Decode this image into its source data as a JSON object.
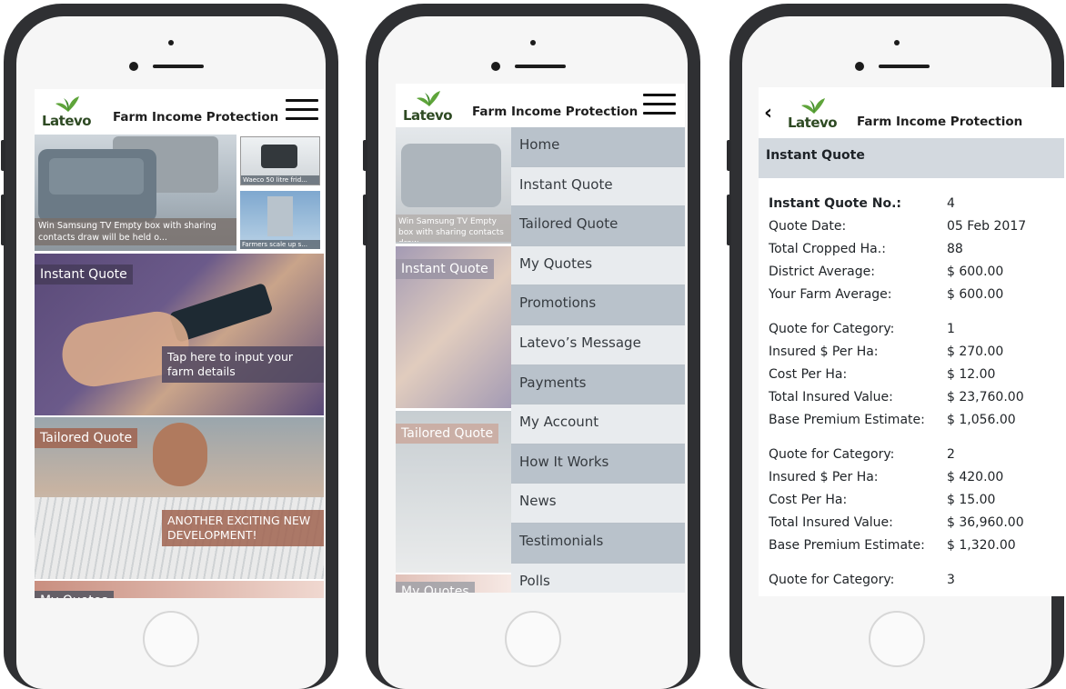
{
  "app": {
    "brand": "Latevo",
    "title": "Farm Income Protection",
    "colors": {
      "logo_green": "#5ea43a",
      "logo_text": "#2e4a23",
      "menu_bg": "#dfe3e7",
      "menu_alt": "#b9c2cb",
      "header_bar": "#d3d9df"
    }
  },
  "phone1": {
    "banner": {
      "main_caption": "Win Samsung TV Empty box with sharing contacts draw will be held o...",
      "side_top": "Waeco 50 litre frid...",
      "side_bottom": "Farmers scale up s..."
    },
    "tiles": [
      {
        "tag": "Instant Quote",
        "caption": "Tap here to input your farm details"
      },
      {
        "tag": "Tailored Quote",
        "caption": "ANOTHER EXCITING NEW DEVELOPMENT!"
      },
      {
        "tag": "My Quotes"
      }
    ]
  },
  "phone2": {
    "bg_texts": {
      "banner_caption": "Win Samsung TV Empty box with sharing contacts draw",
      "tile1": "Instant Quote",
      "tile2": "Tailored Quote",
      "tile3": "My Quotes"
    },
    "menu": [
      {
        "label": "Home"
      },
      {
        "label": "Instant Quote"
      },
      {
        "label": "Tailored Quote"
      },
      {
        "label": "My Quotes"
      },
      {
        "label": "Promotions"
      },
      {
        "label": "Latevo’s Message"
      },
      {
        "label": "Payments"
      },
      {
        "label": "My Account"
      },
      {
        "label": "How It Works"
      },
      {
        "label": "News"
      },
      {
        "label": "Testimonials"
      },
      {
        "label": "Polls"
      }
    ]
  },
  "phone3": {
    "section_title": "Instant Quote",
    "rows": [
      {
        "k": "Instant Quote No.:",
        "v": "4"
      },
      {
        "k": "Quote Date:",
        "v": "05 Feb 2017"
      },
      {
        "k": "Total Cropped Ha.:",
        "v": "88"
      },
      {
        "k": "District Average:",
        "v": "$ 600.00"
      },
      {
        "k": "Your Farm Average:",
        "v": "$ 600.00"
      },
      {
        "k": "Quote for Category:",
        "v": "1"
      },
      {
        "k": "Insured $ Per Ha:",
        "v": "$ 270.00"
      },
      {
        "k": "Cost Per Ha:",
        "v": "$ 12.00"
      },
      {
        "k": "Total Insured Value:",
        "v": "$ 23,760.00"
      },
      {
        "k": "Base Premium Estimate:",
        "v": "$ 1,056.00"
      },
      {
        "k": "Quote for Category:",
        "v": "2"
      },
      {
        "k": "Insured $ Per Ha:",
        "v": "$ 420.00"
      },
      {
        "k": "Cost Per Ha:",
        "v": "$ 15.00"
      },
      {
        "k": "Total Insured Value:",
        "v": "$ 36,960.00"
      },
      {
        "k": "Base Premium Estimate:",
        "v": "$ 1,320.00"
      },
      {
        "k": "Quote for Category:",
        "v": "3"
      }
    ]
  }
}
